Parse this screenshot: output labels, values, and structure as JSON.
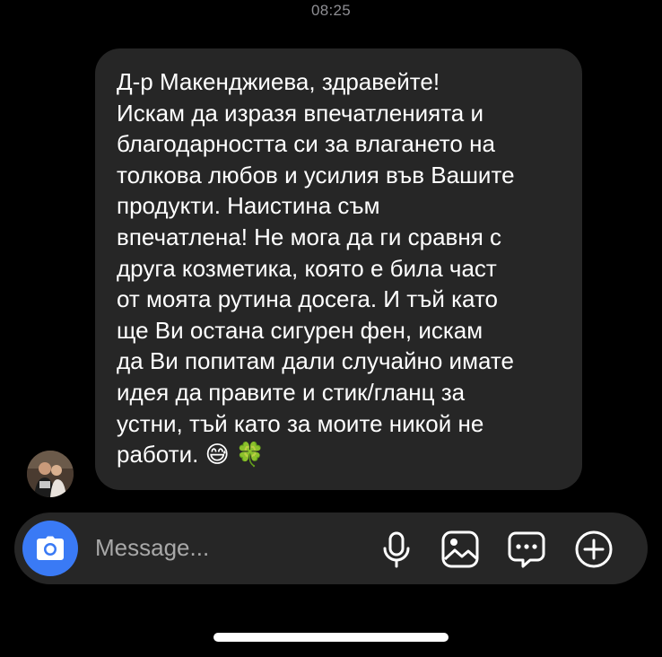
{
  "chat": {
    "timestamp": "08:25",
    "message": {
      "lines": [
        "Д-р Макенджиева, здравейте!",
        "Искам да изразя впечатленията и",
        "благодарността си за влагането на",
        "толкова любов и усилия във Вашите",
        "продукти. Наистина съм",
        "впечатлена! Не мога да ги сравня с",
        "друга козметика, която е била част",
        "от моята рутина досега. И тъй като",
        "ще Ви остана сигурен фен, искам",
        "да Ви попитам дали случайно имате",
        "идея да правите и стик/гланц за",
        "устни, тъй като за моите никой не",
        "работи. 😅 🍀"
      ],
      "emojis": [
        "😅",
        "🍀"
      ]
    }
  },
  "composer": {
    "placeholder": "Message...",
    "icons": [
      "camera-icon",
      "microphone-icon",
      "gallery-icon",
      "sticker-chat-icon",
      "add-icon"
    ],
    "camera_color": "#3a7af5"
  }
}
